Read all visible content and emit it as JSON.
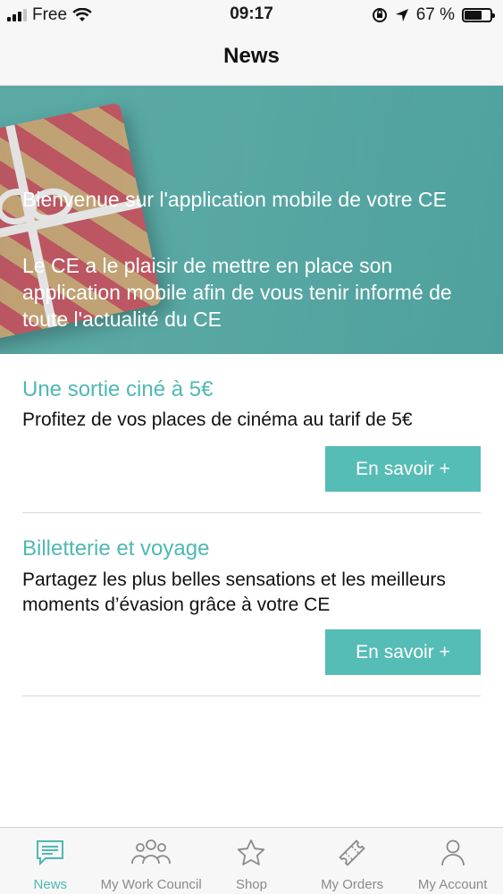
{
  "status_bar": {
    "carrier": "Free",
    "time": "09:17",
    "battery_text": "67 %",
    "battery_level": 0.67
  },
  "header": {
    "title": "News"
  },
  "hero": {
    "title": "Bienvenue sur l'application mobile de votre CE",
    "text": "Le CE a le plaisir de mettre en place son application mobile afin de vous tenir informé de toute l'actualité du CE"
  },
  "articles": [
    {
      "title": "Une sortie ciné à 5€",
      "text": "Profitez de vos places de cinéma au tarif de 5€",
      "button": "En savoir +"
    },
    {
      "title": "Billetterie et voyage",
      "text": "Partagez les plus belles sensations et les meilleurs moments d’évasion grâce à votre CE",
      "button": "En savoir +"
    }
  ],
  "tab_bar": {
    "items": [
      {
        "label": "News",
        "icon": "chat-icon",
        "active": true
      },
      {
        "label": "My Work Council",
        "icon": "people-icon",
        "active": false
      },
      {
        "label": "Shop",
        "icon": "star-icon",
        "active": false
      },
      {
        "label": "My Orders",
        "icon": "ticket-icon",
        "active": false
      },
      {
        "label": "My Account",
        "icon": "user-icon",
        "active": false
      }
    ]
  },
  "colors": {
    "accent": "#4fb8b2",
    "button": "#56bcb6",
    "inactive": "#8a8a8a"
  }
}
